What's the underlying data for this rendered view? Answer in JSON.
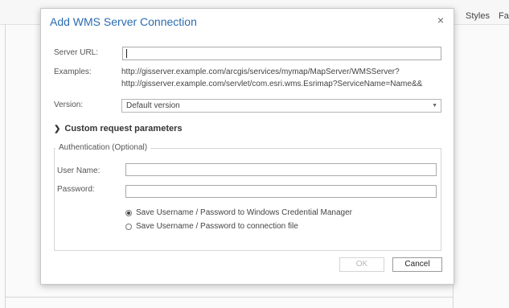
{
  "background": {
    "tabs": [
      "Styles",
      "Fa"
    ]
  },
  "dialog": {
    "title": "Add WMS Server Connection",
    "close_glyph": "×",
    "server_url": {
      "label": "Server URL:",
      "value": ""
    },
    "examples": {
      "label": "Examples:",
      "lines": [
        "http://gisserver.example.com/arcgis/services/mymap/MapServer/WMSServer?",
        "http://gisserver.example.com/servlet/com.esri.wms.Esrimap?ServiceName=Name&&"
      ]
    },
    "version": {
      "label": "Version:",
      "selected": "Default version"
    },
    "custom_request": {
      "label": "Custom request parameters",
      "expanded": false
    },
    "authentication": {
      "legend": "Authentication (Optional)",
      "username_label": "User Name:",
      "username_value": "",
      "password_label": "Password:",
      "password_value": "",
      "options": [
        {
          "label": "Save Username / Password to Windows Credential Manager",
          "checked": true
        },
        {
          "label": "Save Username / Password to connection file",
          "checked": false
        }
      ]
    },
    "buttons": {
      "ok": {
        "label": "OK",
        "enabled": false
      },
      "cancel": {
        "label": "Cancel",
        "enabled": true
      }
    }
  },
  "colors": {
    "title": "#2b6cb0",
    "border": "#c9c9c9"
  },
  "icons": {
    "close": "close-icon",
    "expander": "chevron-right-icon",
    "dropdown": "chevron-down-icon"
  }
}
